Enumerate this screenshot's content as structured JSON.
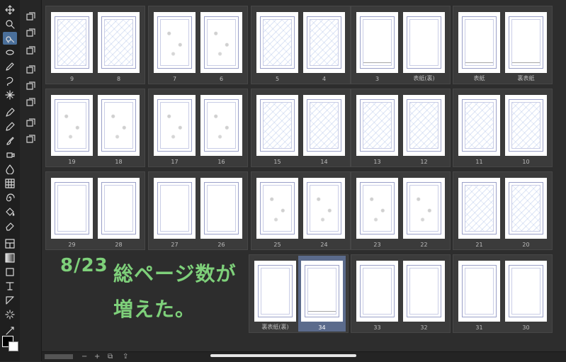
{
  "toolbar": {
    "tools": [
      "move-icon",
      "zoom-icon",
      "operation-icon",
      "lasso-select-icon",
      "eyedropper-icon",
      "loop-select-icon",
      "magic-wand-icon",
      "pen-icon",
      "pencil-icon",
      "brush-icon",
      "airbrush-icon",
      "blend-icon",
      "pattern-icon",
      "spiral-icon",
      "fill-icon",
      "eraser-icon",
      "frame-icon",
      "gradient-icon",
      "rectangle-icon",
      "text-icon",
      "balloon-icon",
      "effect-line-icon",
      "ruler-icon"
    ],
    "active_tool": "operation-icon"
  },
  "subtools": [
    "layers-icon",
    "copy-layers-icon",
    "adjust-icon",
    "camera-icon",
    "dialog-icon",
    "film-icon",
    "merge-icon",
    "close-icon"
  ],
  "spreads": [
    {
      "pages": [
        {
          "label": "9",
          "style": "sketch"
        },
        {
          "label": "8",
          "style": "sketch"
        }
      ]
    },
    {
      "pages": [
        {
          "label": "7",
          "style": "rough"
        },
        {
          "label": "6",
          "style": "rough"
        }
      ]
    },
    {
      "pages": [
        {
          "label": "5",
          "style": "sketch"
        },
        {
          "label": "4",
          "style": "sketch"
        }
      ]
    },
    {
      "pages": [
        {
          "label": "3",
          "style": "text"
        },
        {
          "label": "表紙(裏)",
          "style": "blank"
        }
      ]
    },
    {
      "pages": [
        {
          "label": "表紙",
          "style": "text"
        },
        {
          "label": "裏表紙",
          "style": "text"
        }
      ]
    },
    {
      "pages": [
        {
          "label": "19",
          "style": "rough"
        },
        {
          "label": "18",
          "style": "rough"
        }
      ]
    },
    {
      "pages": [
        {
          "label": "17",
          "style": "rough"
        },
        {
          "label": "16",
          "style": "rough"
        }
      ]
    },
    {
      "pages": [
        {
          "label": "15",
          "style": "sketch"
        },
        {
          "label": "14",
          "style": "sketch"
        }
      ]
    },
    {
      "pages": [
        {
          "label": "13",
          "style": "sketch"
        },
        {
          "label": "12",
          "style": "sketch"
        }
      ]
    },
    {
      "pages": [
        {
          "label": "11",
          "style": "sketch"
        },
        {
          "label": "10",
          "style": "sketch"
        }
      ]
    },
    {
      "pages": [
        {
          "label": "29",
          "style": "blank"
        },
        {
          "label": "28",
          "style": "blank"
        }
      ]
    },
    {
      "pages": [
        {
          "label": "27",
          "style": "blank"
        },
        {
          "label": "26",
          "style": "blank"
        }
      ]
    },
    {
      "pages": [
        {
          "label": "25",
          "style": "rough"
        },
        {
          "label": "24",
          "style": "rough"
        }
      ]
    },
    {
      "pages": [
        {
          "label": "23",
          "style": "rough"
        },
        {
          "label": "22",
          "style": "rough"
        }
      ]
    },
    {
      "pages": [
        {
          "label": "21",
          "style": "sketch"
        },
        {
          "label": "20",
          "style": "sketch"
        }
      ]
    },
    {
      "pages": [
        {
          "label": "裏表紙(裏)",
          "style": "blank"
        },
        {
          "label": "34",
          "style": "text"
        }
      ]
    },
    {
      "pages": [
        {
          "label": "33",
          "style": "blank"
        },
        {
          "label": "32",
          "style": "blank"
        }
      ]
    },
    {
      "pages": [
        {
          "label": "31",
          "style": "blank"
        },
        {
          "label": "30",
          "style": "blank"
        }
      ]
    }
  ],
  "selected_page": "34",
  "note": {
    "line1": "8/23",
    "line2": "総ページ数が",
    "line3": "増えた。"
  },
  "bottom": {
    "minus": "−",
    "plus": "+"
  },
  "colors": {
    "accent": "#4a6f9a",
    "note": "#7ed07a",
    "selected": "#5b6b8c"
  }
}
